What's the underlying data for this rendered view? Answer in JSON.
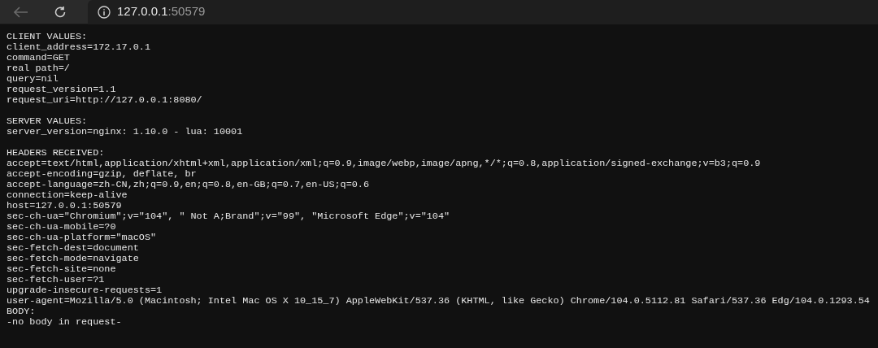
{
  "address_bar": {
    "host": "127.0.0.1",
    "port": ":50579"
  },
  "back_button": {
    "disabled": true
  },
  "sections": [
    {
      "heading": "CLIENT VALUES:",
      "blank_line_before": false,
      "lines": [
        "client_address=172.17.0.1",
        "command=GET",
        "real path=/",
        "query=nil",
        "request_version=1.1",
        "request_uri=http://127.0.0.1:8080/"
      ]
    },
    {
      "heading": "SERVER VALUES:",
      "blank_line_before": true,
      "lines": [
        "server_version=nginx: 1.10.0 - lua: 10001"
      ]
    },
    {
      "heading": "HEADERS RECEIVED:",
      "blank_line_before": true,
      "lines": [
        "accept=text/html,application/xhtml+xml,application/xml;q=0.9,image/webp,image/apng,*/*;q=0.8,application/signed-exchange;v=b3;q=0.9",
        "accept-encoding=gzip, deflate, br",
        "accept-language=zh-CN,zh;q=0.9,en;q=0.8,en-GB;q=0.7,en-US;q=0.6",
        "connection=keep-alive",
        "host=127.0.0.1:50579",
        "sec-ch-ua=\"Chromium\";v=\"104\", \" Not A;Brand\";v=\"99\", \"Microsoft Edge\";v=\"104\"",
        "sec-ch-ua-mobile=?0",
        "sec-ch-ua-platform=\"macOS\"",
        "sec-fetch-dest=document",
        "sec-fetch-mode=navigate",
        "sec-fetch-site=none",
        "sec-fetch-user=?1",
        "upgrade-insecure-requests=1",
        "user-agent=Mozilla/5.0 (Macintosh; Intel Mac OS X 10_15_7) AppleWebKit/537.36 (KHTML, like Gecko) Chrome/104.0.5112.81 Safari/537.36 Edg/104.0.1293.54"
      ]
    },
    {
      "heading": "BODY:",
      "blank_line_before": false,
      "lines": [
        "-no body in request-"
      ]
    }
  ]
}
